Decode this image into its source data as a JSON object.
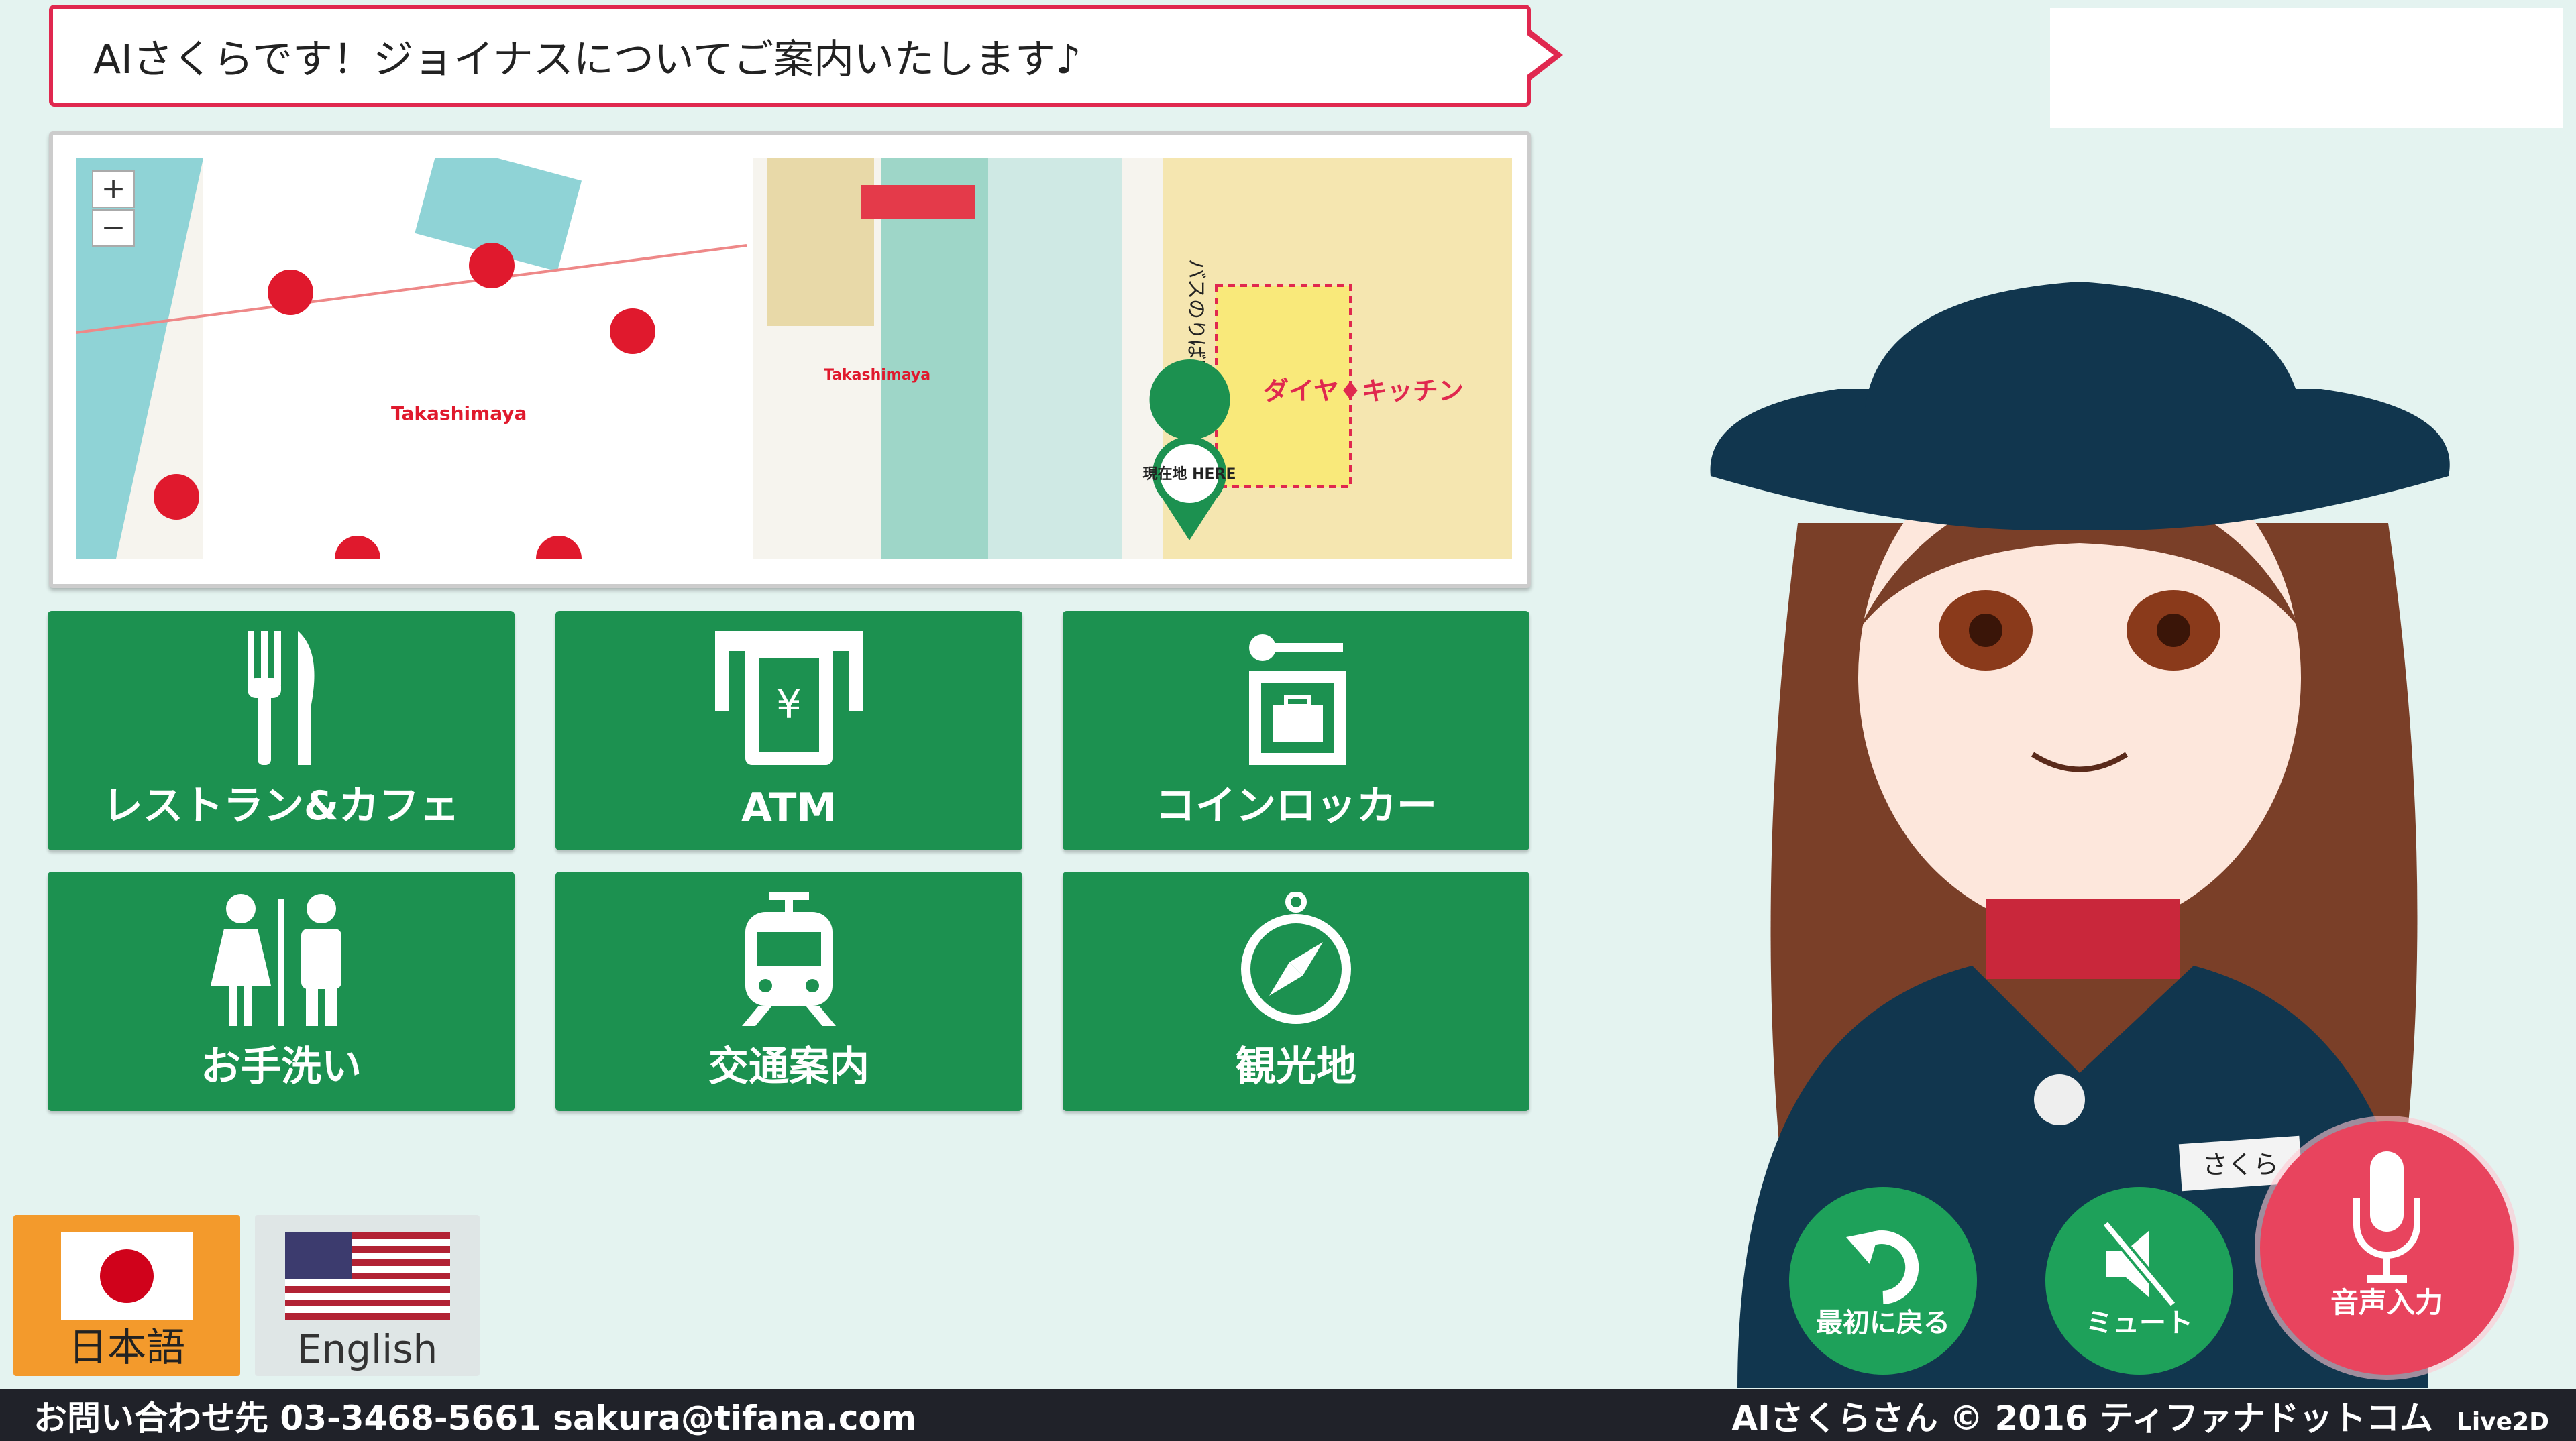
{
  "bubble": {
    "message": "AIさくらです！ジョイナスについてご案内いたします♪"
  },
  "map": {
    "zoom_in": "+",
    "zoom_out": "−",
    "here_label": "現在地 HERE",
    "store_label": "Takashimaya",
    "kitchen_label": "ダイヤ♦キッチン",
    "bus_label": "バスのりば案内図"
  },
  "categories": [
    {
      "label": "レストラン&カフェ",
      "icon": "fork-knife-icon"
    },
    {
      "label": "ATM",
      "icon": "atm-icon"
    },
    {
      "label": "コインロッカー",
      "icon": "locker-icon"
    },
    {
      "label": "お手洗い",
      "icon": "restroom-icon"
    },
    {
      "label": "交通案内",
      "icon": "train-icon"
    },
    {
      "label": "観光地",
      "icon": "compass-icon"
    }
  ],
  "languages": [
    {
      "label": "日本語",
      "flag": "japan-flag-icon"
    },
    {
      "label": "English",
      "flag": "us-flag-icon"
    }
  ],
  "controls": {
    "reset": "最初に戻る",
    "mute": "ミュート",
    "voice": "音声入力"
  },
  "character": {
    "name_tag": "さくら"
  },
  "footer": {
    "contact": "お問い合わせ先 03-3468-5661 sakura@tifana.com",
    "copyright": "AIさくらさん © 2016 ティファナドットコム",
    "live2d": "Live2D"
  },
  "colors": {
    "green": "#1c9150",
    "red": "#e8445e",
    "accent": "#e0284f",
    "footer": "#202229",
    "background": "#e4f3f0"
  }
}
